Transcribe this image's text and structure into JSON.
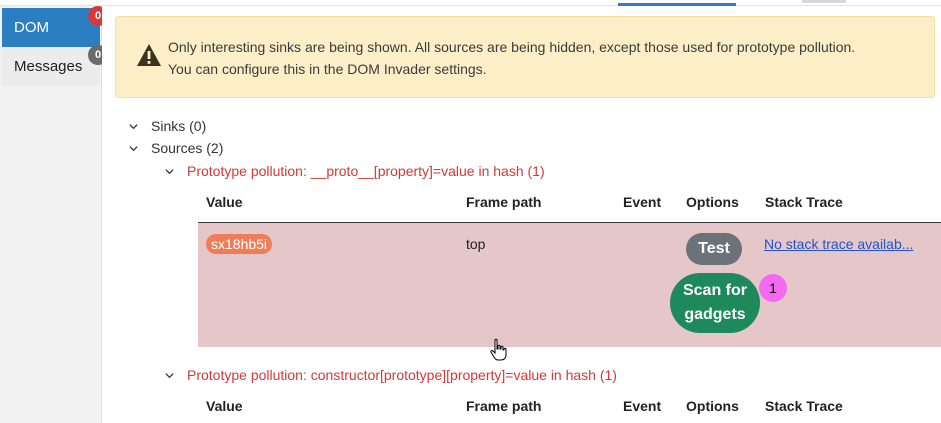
{
  "sidebar": {
    "items": [
      {
        "label": "DOM",
        "badge": "0"
      },
      {
        "label": "Messages",
        "badge": "0"
      }
    ]
  },
  "alert": {
    "icon": "warning-icon",
    "line1": "Only interesting sinks are being shown. All sources are being hidden, except those used for prototype pollution.",
    "line2": "You can configure this in the DOM Invader settings."
  },
  "tree": {
    "sinks": "Sinks (0)",
    "sources": "Sources (2)",
    "groups": [
      {
        "label": "Prototype pollution: __proto__[property]=value in hash (1)"
      },
      {
        "label": "Prototype pollution: constructor[prototype][property]=value in hash (1)"
      }
    ]
  },
  "table": {
    "headers": [
      "Value",
      "Frame path",
      "Event",
      "Options",
      "Stack Trace"
    ],
    "row": {
      "value": "sx18hb5i",
      "frame_path": "top",
      "event": "",
      "test_label": "Test",
      "scan_label_1": "Scan for",
      "scan_label_2": "gadgets",
      "scan_count": "1",
      "stack_trace": "No stack trace availab..."
    }
  },
  "colors": {
    "accent": "#2b7ec1",
    "badge_red": "#d9363e",
    "alert_bg": "#fcefc7",
    "row_bg": "#e5c6c9",
    "pill": "#ee7d5a",
    "scan_green": "#1e8a5b",
    "count_pink": "#f36af0",
    "red_text": "#cf3a3a"
  }
}
